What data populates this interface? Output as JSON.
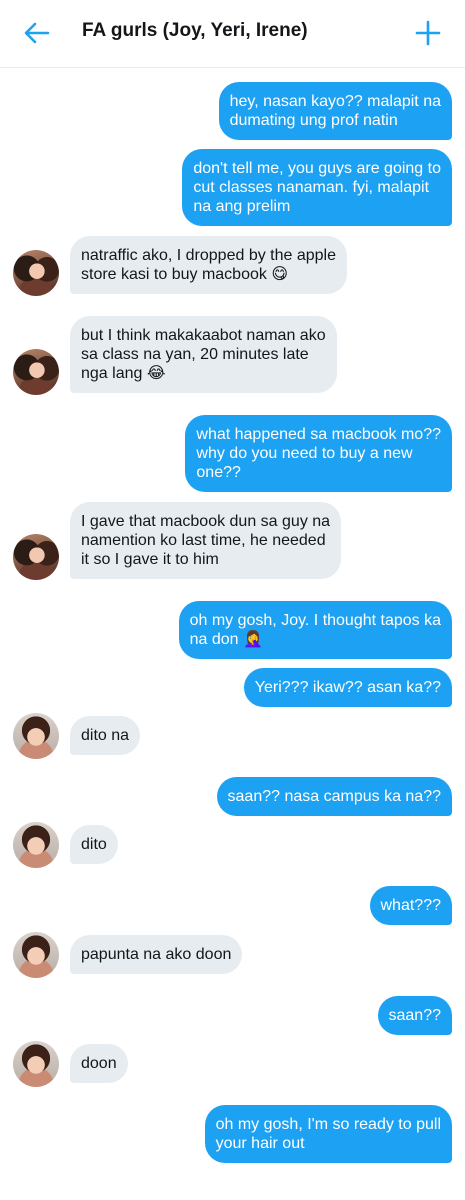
{
  "header": {
    "title": "FA gurls (Joy, Yeri, Irene)",
    "accent_color": "#1da1f2",
    "back_icon": "arrow-left-icon",
    "add_icon": "plus-icon"
  },
  "messages": [
    {
      "side": "out",
      "text": "hey, nasan kayo?? malapit na\ndumating ung prof natin"
    },
    {
      "side": "out",
      "text": "don't tell me, you guys are going to\ncut classes nanaman. fyi, malapit\nna ang prelim"
    },
    {
      "side": "in",
      "avatar": "joy",
      "text": "natraffic ako, I dropped by the apple\nstore kasi to buy macbook 😋"
    },
    {
      "side": "in",
      "avatar": "joy",
      "text": "but I think makakaabot naman ako\nsa class na yan, 20 minutes late\nnga lang 😂"
    },
    {
      "side": "out",
      "text": "what happened sa macbook mo??\nwhy do you need to buy a new\none??"
    },
    {
      "side": "in",
      "avatar": "joy",
      "text": "I gave that macbook dun sa guy na\nnamention ko last time, he needed\nit so I gave it to him"
    },
    {
      "side": "out",
      "text": "oh my gosh, Joy. I thought tapos ka\nna don 🤦‍♀️"
    },
    {
      "side": "out",
      "text": "Yeri??? ikaw?? asan ka??"
    },
    {
      "side": "in",
      "avatar": "yeri",
      "text": "dito na"
    },
    {
      "side": "out",
      "text": "saan?? nasa campus ka na??"
    },
    {
      "side": "in",
      "avatar": "yeri",
      "text": "dito"
    },
    {
      "side": "out",
      "text": "what???"
    },
    {
      "side": "in",
      "avatar": "yeri",
      "text": "papunta na ako doon"
    },
    {
      "side": "out",
      "text": "saan??"
    },
    {
      "side": "in",
      "avatar": "yeri",
      "text": "doon"
    },
    {
      "side": "out",
      "text": "oh my gosh, I'm so ready to pull\nyour hair out"
    }
  ]
}
